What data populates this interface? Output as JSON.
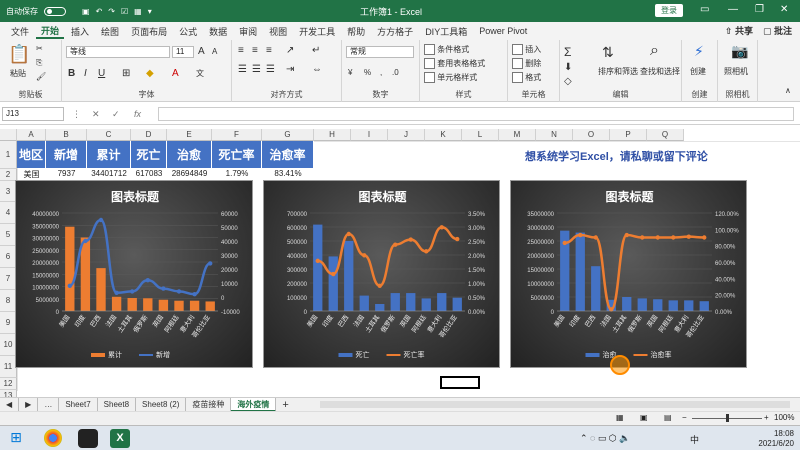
{
  "titlebar": {
    "autosave": "自动保存",
    "doc": "工作簿1 - Excel",
    "login": "登录",
    "minimize": "—",
    "restore": "❐",
    "close": "✕"
  },
  "menu": {
    "items": [
      "文件",
      "开始",
      "插入",
      "绘图",
      "页面布局",
      "公式",
      "数据",
      "审阅",
      "视图",
      "开发工具",
      "帮助",
      "方方格子",
      "DIY工具箱",
      "Power Pivot"
    ],
    "active_index": 1,
    "share": "共享",
    "comment": "批注"
  },
  "ribbon": {
    "paste": "粘贴",
    "clipboard": "剪贴板",
    "font_name": "等线",
    "font_size": "11",
    "font_group": "字体",
    "bold": "B",
    "italic": "I",
    "underline": "U",
    "grow": "A",
    "shrink": "A",
    "align_group": "对齐方式",
    "number_format": "常规",
    "number_group": "数字",
    "cond_format": "条件格式",
    "table_format": "套用表格格式",
    "cell_style": "单元格样式",
    "style_group": "样式",
    "insert": "插入",
    "delete": "删除",
    "format": "格式",
    "cells_group": "单元格",
    "sort_filter": "排序和筛选",
    "find_select": "查找和选择",
    "edit_group": "编辑",
    "create": "创建",
    "create_group": "创建",
    "camera": "照相机",
    "camera_group": "照相机"
  },
  "formula": {
    "namebox": "J13",
    "cancel": "✕",
    "enter": "✓",
    "fx": "fx"
  },
  "columns": [
    "A",
    "B",
    "C",
    "D",
    "E",
    "F",
    "G",
    "H",
    "I",
    "J",
    "K",
    "L",
    "M",
    "N",
    "O",
    "P",
    "Q"
  ],
  "rows": [
    "1",
    "2",
    "3",
    "4",
    "5",
    "6",
    "7",
    "8",
    "9",
    "10",
    "11",
    "12",
    "13",
    "14"
  ],
  "table": {
    "headers": [
      "地区",
      "新增",
      "累计",
      "死亡",
      "治愈",
      "死亡率",
      "治愈率"
    ],
    "row2": [
      "美国",
      "7937",
      "34401712",
      "617083",
      "28694849",
      "1.79%",
      "83.41%"
    ]
  },
  "note": "想系统学习Excel，请私聊或留下评论",
  "charts": [
    {
      "title": "图表标题",
      "left_ticks": [
        "40000000",
        "35000000",
        "30000000",
        "25000000",
        "20000000",
        "15000000",
        "10000000",
        "5000000",
        "0"
      ],
      "right_ticks": [
        "60000",
        "50000",
        "40000",
        "30000",
        "20000",
        "10000",
        "0",
        "-10000"
      ],
      "categories": [
        "美国",
        "印度",
        "巴西",
        "法国",
        "土耳其",
        "俄罗斯",
        "英国",
        "阿根廷",
        "意大利",
        "哥伦比亚"
      ],
      "legend": [
        "累计",
        "新增"
      ]
    },
    {
      "title": "图表标题",
      "left_ticks": [
        "700000",
        "600000",
        "500000",
        "400000",
        "300000",
        "200000",
        "100000",
        "0"
      ],
      "right_ticks": [
        "3.50%",
        "3.00%",
        "2.50%",
        "2.00%",
        "1.50%",
        "1.00%",
        "0.50%",
        "0.00%"
      ],
      "categories": [
        "美国",
        "印度",
        "巴西",
        "法国",
        "土耳其",
        "俄罗斯",
        "英国",
        "阿根廷",
        "意大利",
        "哥伦比亚"
      ],
      "legend": [
        "死亡",
        "死亡率"
      ]
    },
    {
      "title": "图表标题",
      "left_ticks": [
        "35000000",
        "30000000",
        "25000000",
        "20000000",
        "15000000",
        "10000000",
        "5000000",
        "0"
      ],
      "right_ticks": [
        "120.00%",
        "100.00%",
        "80.00%",
        "60.00%",
        "40.00%",
        "20.00%",
        "0.00%"
      ],
      "categories": [
        "美国",
        "印度",
        "巴西",
        "法国",
        "土耳其",
        "俄罗斯",
        "英国",
        "阿根廷",
        "意大利",
        "哥伦比亚"
      ],
      "legend": [
        "治愈",
        "治愈率"
      ]
    }
  ],
  "chart_data": [
    {
      "type": "bar",
      "title": "图表标题",
      "categories": [
        "美国",
        "印度",
        "巴西",
        "法国",
        "土耳其",
        "俄罗斯",
        "英国",
        "阿根廷",
        "意大利",
        "哥伦比亚"
      ],
      "series": [
        {
          "name": "累计",
          "type": "bar",
          "axis": "left",
          "color": "#ed7d31",
          "values": [
            34401712,
            30000000,
            17500000,
            5800000,
            5300000,
            5200000,
            4600000,
            4200000,
            4200000,
            3900000
          ]
        },
        {
          "name": "新增",
          "type": "line",
          "axis": "right",
          "color": "#4472c4",
          "values": [
            8000,
            40000,
            55000,
            3000,
            4000,
            12000,
            6000,
            4000,
            2000,
            24000
          ]
        }
      ],
      "ylim_left": [
        0,
        40000000
      ],
      "ylim_right": [
        -10000,
        60000
      ]
    },
    {
      "type": "bar",
      "title": "图表标题",
      "categories": [
        "美国",
        "印度",
        "巴西",
        "法国",
        "土耳其",
        "俄罗斯",
        "英国",
        "阿根廷",
        "意大利",
        "哥伦比亚"
      ],
      "series": [
        {
          "name": "死亡",
          "type": "bar",
          "axis": "left",
          "color": "#4472c4",
          "values": [
            617083,
            390000,
            500000,
            110000,
            50000,
            128000,
            128000,
            90000,
            128000,
            95000
          ]
        },
        {
          "name": "死亡率",
          "type": "line",
          "axis": "right",
          "color": "#ed7d31",
          "values": [
            0.0179,
            0.0132,
            0.0275,
            0.0199,
            0.009,
            0.0237,
            0.0255,
            0.0213,
            0.0299,
            0.0257
          ]
        }
      ],
      "ylim_left": [
        0,
        700000
      ],
      "ylim_right": [
        0,
        0.035
      ]
    },
    {
      "type": "bar",
      "title": "图表标题",
      "categories": [
        "美国",
        "印度",
        "巴西",
        "法国",
        "土耳其",
        "俄罗斯",
        "英国",
        "阿根廷",
        "意大利",
        "哥伦比亚"
      ],
      "series": [
        {
          "name": "治愈",
          "type": "bar",
          "axis": "left",
          "color": "#4472c4",
          "values": [
            28694849,
            28000000,
            16000000,
            4000000,
            5000000,
            4500000,
            4200000,
            3800000,
            3800000,
            3500000
          ]
        },
        {
          "name": "治愈率",
          "type": "line",
          "axis": "right",
          "color": "#ed7d31",
          "values": [
            0.834,
            0.93,
            0.9,
            0.02,
            0.93,
            0.9,
            0.9,
            0.9,
            0.91,
            0.9
          ]
        }
      ],
      "ylim_left": [
        0,
        35000000
      ],
      "ylim_right": [
        0,
        1.2
      ]
    }
  ],
  "sheets": {
    "nav": "…",
    "tabs": [
      "Sheet7",
      "Sheet8",
      "Sheet8 (2)",
      "疫苗接种",
      "海外疫情"
    ],
    "active_index": 4,
    "add": "+"
  },
  "status": {
    "zoom": "100%"
  },
  "taskbar": {
    "time": "18:08",
    "date": "2021/6/20",
    "ime": "中"
  }
}
